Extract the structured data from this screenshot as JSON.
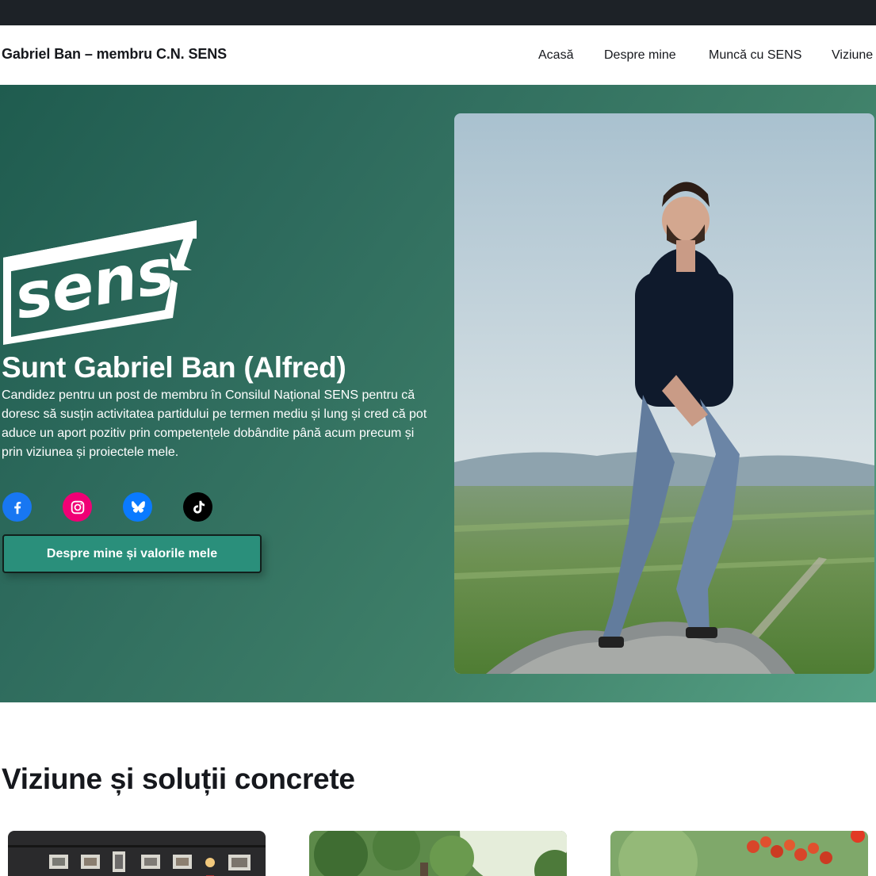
{
  "nav": {
    "brand": "Gabriel Ban – membru C.N. SENS",
    "links": [
      {
        "label": "Acasă"
      },
      {
        "label": "Despre mine"
      },
      {
        "label": "Muncă cu SENS"
      },
      {
        "label": "Viziune"
      }
    ]
  },
  "hero": {
    "logo_text": "sens",
    "title": "Sunt Gabriel Ban (Alfred)",
    "description": "Candidez pentru un post de membru în Consilul Național SENS pentru că doresc să susțin activitatea partidului pe termen mediu și lung și cred că pot aduce un aport pozitiv prin competențele dobândite până acum precum și prin viziunea și proiectele mele.",
    "social": [
      {
        "icon": "facebook-icon",
        "color": "#1877f2"
      },
      {
        "icon": "instagram-icon",
        "color": "#f00075"
      },
      {
        "icon": "bluesky-icon",
        "color": "#0a7aff"
      },
      {
        "icon": "tiktok-icon",
        "color": "#000000"
      }
    ],
    "cta_label": "Despre mine și valorile mele",
    "accent_color": "#2a8f7b"
  },
  "vision": {
    "title": "Viziune și soluții concrete"
  }
}
